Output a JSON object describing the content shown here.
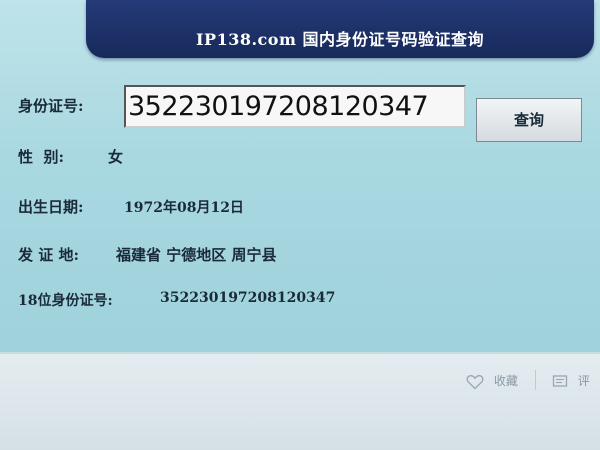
{
  "header": {
    "title": "IP138.com 国内身份证号码验证查询"
  },
  "form": {
    "id_label": "身份证号:",
    "id_value": "352230197208120347",
    "query_button": "查询"
  },
  "results": {
    "gender_label": "性  别:",
    "gender_value": "女",
    "birth_label": "出生日期:",
    "birth_value": "1972年08月12日",
    "place_label": "发 证 地:",
    "place_value": "福建省 宁德地区 周宁县",
    "id18_label": "18位身份证号:",
    "id18_value": "352230197208120347"
  },
  "footer": {
    "favorite_label": "收藏",
    "comment_label": "评",
    "favorite_icon": "heart-icon",
    "comment_icon": "comment-icon"
  }
}
